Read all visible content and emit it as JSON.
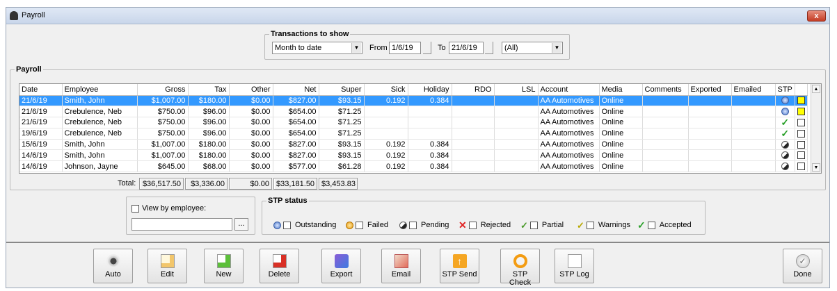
{
  "window": {
    "title": "Payroll",
    "close_label": "x"
  },
  "filters": {
    "legend": "Transactions to show",
    "period": "Month to date",
    "from_label": "From",
    "from_date": "1/6/19",
    "to_label": "To",
    "to_date": "21/6/19",
    "scope": "(All)"
  },
  "grid": {
    "legend": "Payroll",
    "columns": [
      "Date",
      "Employee",
      "Gross",
      "Tax",
      "Other",
      "Net",
      "Super",
      "Sick",
      "Holiday",
      "RDO",
      "LSL",
      "Account",
      "Media",
      "Comments",
      "Exported",
      "Emailed",
      "STP"
    ],
    "rows": [
      {
        "date": "21/6/19",
        "employee": "Smith, John",
        "gross": "$1,007.00",
        "tax": "$180.00",
        "other": "$0.00",
        "net": "$827.00",
        "super": "$93.15",
        "sick": "0.192",
        "holiday": "0.384",
        "rdo": "",
        "lsl": "",
        "account": "AA Automotives",
        "media": "Online",
        "comments": "",
        "exported": "",
        "emailed": "",
        "stp": "outstanding",
        "selected": true,
        "flag": "yellow"
      },
      {
        "date": "21/6/19",
        "employee": "Crebulence, Neb",
        "gross": "$750.00",
        "tax": "$96.00",
        "other": "$0.00",
        "net": "$654.00",
        "super": "$71.25",
        "sick": "",
        "holiday": "",
        "rdo": "",
        "lsl": "",
        "account": "AA Automotives",
        "media": "Online",
        "comments": "",
        "exported": "",
        "emailed": "",
        "stp": "outstanding",
        "selected": false,
        "flag": "yellow"
      },
      {
        "date": "21/6/19",
        "employee": "Crebulence, Neb",
        "gross": "$750.00",
        "tax": "$96.00",
        "other": "$0.00",
        "net": "$654.00",
        "super": "$71.25",
        "sick": "",
        "holiday": "",
        "rdo": "",
        "lsl": "",
        "account": "AA Automotives",
        "media": "Online",
        "comments": "",
        "exported": "",
        "emailed": "",
        "stp": "accepted",
        "selected": false,
        "flag": "none"
      },
      {
        "date": "19/6/19",
        "employee": "Crebulence, Neb",
        "gross": "$750.00",
        "tax": "$96.00",
        "other": "$0.00",
        "net": "$654.00",
        "super": "$71.25",
        "sick": "",
        "holiday": "",
        "rdo": "",
        "lsl": "",
        "account": "AA Automotives",
        "media": "Online",
        "comments": "",
        "exported": "",
        "emailed": "",
        "stp": "accepted",
        "selected": false,
        "flag": "none"
      },
      {
        "date": "15/6/19",
        "employee": "Smith, John",
        "gross": "$1,007.00",
        "tax": "$180.00",
        "other": "$0.00",
        "net": "$827.00",
        "super": "$93.15",
        "sick": "0.192",
        "holiday": "0.384",
        "rdo": "",
        "lsl": "",
        "account": "AA Automotives",
        "media": "Online",
        "comments": "",
        "exported": "",
        "emailed": "",
        "stp": "pending",
        "selected": false,
        "flag": "none"
      },
      {
        "date": "14/6/19",
        "employee": "Smith, John",
        "gross": "$1,007.00",
        "tax": "$180.00",
        "other": "$0.00",
        "net": "$827.00",
        "super": "$93.15",
        "sick": "0.192",
        "holiday": "0.384",
        "rdo": "",
        "lsl": "",
        "account": "AA Automotives",
        "media": "Online",
        "comments": "",
        "exported": "",
        "emailed": "",
        "stp": "pending",
        "selected": false,
        "flag": "none"
      },
      {
        "date": "14/6/19",
        "employee": "Johnson, Jayne",
        "gross": "$645.00",
        "tax": "$68.00",
        "other": "$0.00",
        "net": "$577.00",
        "super": "$61.28",
        "sick": "0.192",
        "holiday": "0.384",
        "rdo": "",
        "lsl": "",
        "account": "AA Automotives",
        "media": "Online",
        "comments": "",
        "exported": "",
        "emailed": "",
        "stp": "pending",
        "selected": false,
        "flag": "none"
      }
    ]
  },
  "totals": {
    "label": "Total:",
    "gross": "$36,517.50",
    "tax": "$3,336.00",
    "other": "$0.00",
    "net": "$33,181.50",
    "super": "$3,453.83"
  },
  "view_by_employee": {
    "label": "View by employee:",
    "value": "",
    "browse": "..."
  },
  "stp_status": {
    "legend": "STP status",
    "items": [
      {
        "key": "outstanding",
        "label": "Outstanding"
      },
      {
        "key": "fail",
        "label": "Failed"
      },
      {
        "key": "pend",
        "label": "Pending"
      },
      {
        "key": "rej",
        "label": "Rejected"
      },
      {
        "key": "part",
        "label": "Partial"
      },
      {
        "key": "warn",
        "label": "Warnings"
      },
      {
        "key": "acc",
        "label": "Accepted"
      }
    ]
  },
  "toolbar": {
    "buttons": [
      {
        "label": "Auto",
        "icon": "auto-icon"
      },
      {
        "label": "Edit",
        "icon": "edit-icon"
      },
      {
        "label": "New",
        "icon": "new-icon"
      },
      {
        "label": "Delete",
        "icon": "delete-icon"
      },
      {
        "label": "Export",
        "icon": "export-icon"
      },
      {
        "label": "Email",
        "icon": "email-icon"
      },
      {
        "label": "STP Send",
        "icon": "stp-send-icon"
      },
      {
        "label": "STP Check",
        "icon": "stp-check-icon"
      },
      {
        "label": "STP Log",
        "icon": "stp-log-icon"
      },
      {
        "label": "Done",
        "icon": "done-icon"
      }
    ]
  },
  "colors": {
    "selection": "#3399ff",
    "flag": "#ffff00",
    "close": "#c33c24"
  }
}
